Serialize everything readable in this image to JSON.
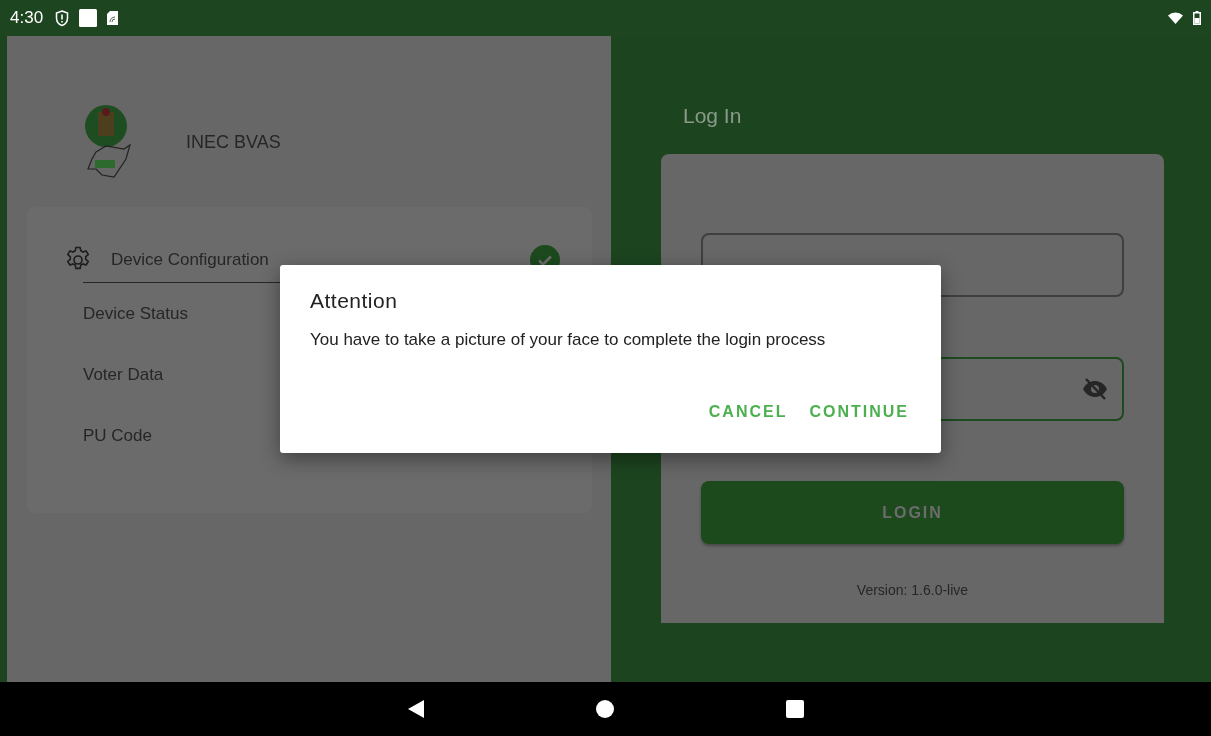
{
  "status_bar": {
    "time": "4:30"
  },
  "app": {
    "title": "INEC BVAS"
  },
  "setup_steps": [
    {
      "kind": "header",
      "label": "Device Configuration",
      "completed": true
    },
    {
      "kind": "item",
      "label": "Device Status"
    },
    {
      "kind": "item",
      "label": "Voter Data"
    },
    {
      "kind": "item",
      "label": "PU Code"
    }
  ],
  "login": {
    "title": "Log In",
    "fields": [
      {
        "kind": "text",
        "focused": false
      },
      {
        "kind": "password",
        "focused": true
      }
    ],
    "button": "LOGIN",
    "version": "Version: 1.6.0-live"
  },
  "dialog": {
    "title": "Attention",
    "message": "You have to take a picture of your face to complete the login process",
    "buttons": [
      "CANCEL",
      "CONTINUE"
    ]
  }
}
